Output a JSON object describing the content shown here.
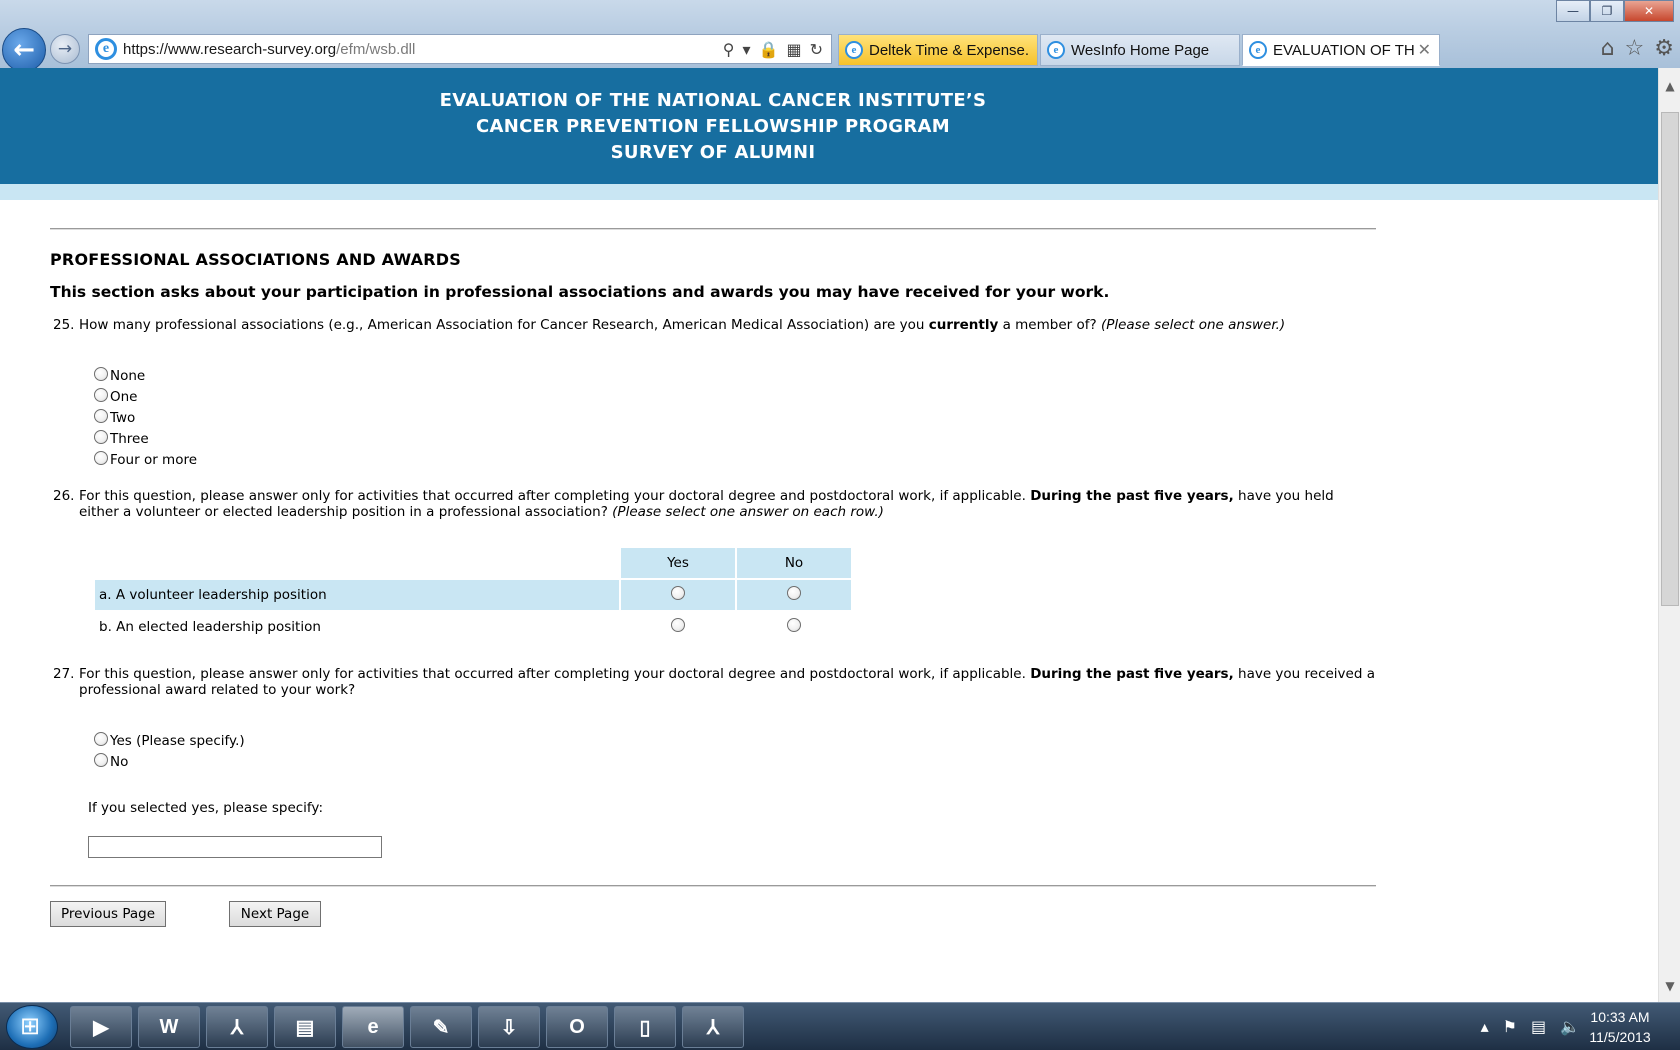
{
  "browser": {
    "url_main": "https://www.research-survey.org",
    "url_path": "/efm/wsb.dll",
    "tabs": [
      {
        "label": "Deltek Time & Expense..."
      },
      {
        "label": "WesInfo Home Page"
      },
      {
        "label": "EVALUATION OF TH..."
      }
    ],
    "window_controls": {
      "minimize": "—",
      "restore": "❐",
      "close": "✕"
    }
  },
  "banner": {
    "line1": "EVALUATION OF THE NATIONAL CANCER INSTITUTE’S",
    "line2": "CANCER PREVENTION FELLOWSHIP PROGRAM",
    "line3": "SURVEY OF ALUMNI"
  },
  "section": {
    "title": "PROFESSIONAL ASSOCIATIONS AND AWARDS",
    "intro": "This section asks about your participation in professional associations and awards you may have received for your work."
  },
  "q25": {
    "number": "25.",
    "text_a": "How many professional associations (e.g., American Association for Cancer Research, American Medical Association) are you ",
    "text_bold": "currently",
    "text_b": " a member of? ",
    "text_italic": "(Please select one answer.)",
    "options": [
      "None",
      "One",
      "Two",
      "Three",
      "Four or more"
    ]
  },
  "q26": {
    "number": "26.",
    "text_a": "For this question, please answer only for activities that occurred after completing your doctoral degree and postdoctoral work, if applicable. ",
    "text_bold": "During the past five years,",
    "text_b": " have you held either a volunteer or elected leadership position in a professional association? ",
    "text_italic": "(Please select one answer on each row.)",
    "columns": [
      "Yes",
      "No"
    ],
    "rows": [
      "a. A volunteer leadership position",
      "b. An elected leadership position"
    ]
  },
  "q27": {
    "number": "27.",
    "text_a": "For this question, please answer only for activities that occurred after completing your doctoral degree and postdoctoral work, if applicable. ",
    "text_bold": "During the past five years,",
    "text_b": " have you received a professional award related to your work?",
    "options": [
      "Yes (Please specify.)",
      "No"
    ],
    "specify_label": "If you selected yes, please specify:",
    "specify_value": ""
  },
  "buttons": {
    "previous": "Previous Page",
    "next": "Next Page"
  },
  "taskbar": {
    "apps": [
      "▶",
      "W",
      "⅄",
      "▤",
      "e",
      "✎",
      "⇩",
      "O",
      "▯",
      "⅄"
    ],
    "time": "10:33 AM",
    "date": "11/5/2013"
  }
}
